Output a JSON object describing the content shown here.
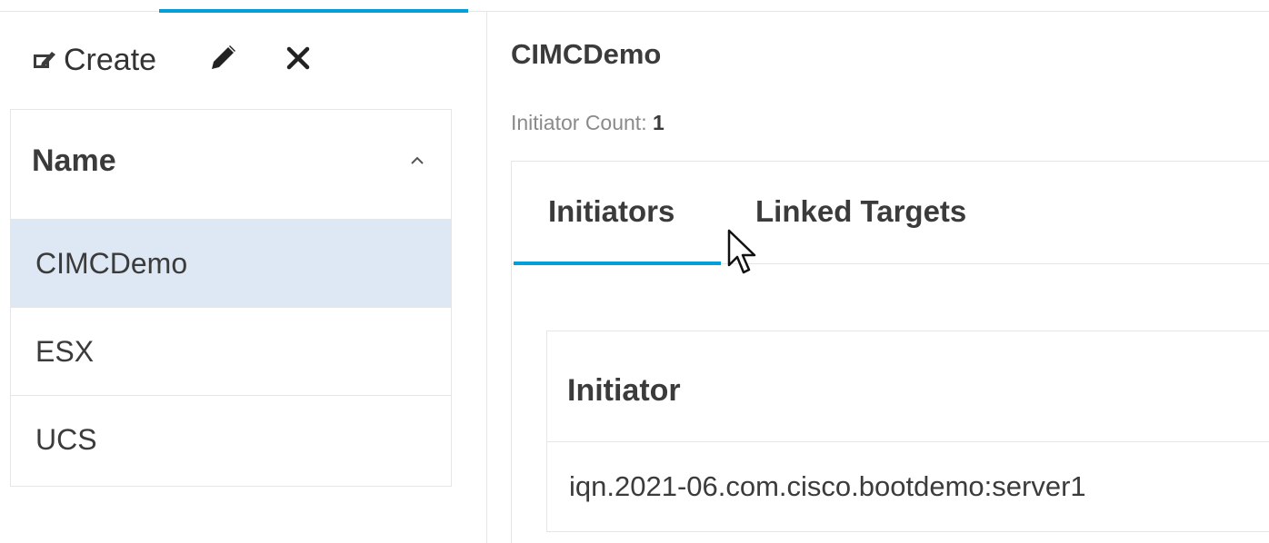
{
  "toolbar": {
    "create_label": "Create",
    "create_icon": "create-edit-icon",
    "edit_icon": "pencil-icon",
    "delete_icon": "close-icon"
  },
  "list": {
    "header": "Name",
    "sort_icon": "chevron-up-icon",
    "rows": [
      "CIMCDemo",
      "ESX",
      "UCS"
    ],
    "selected": "CIMCDemo"
  },
  "detail": {
    "title": "CIMCDemo",
    "count_label": "Initiator Count:",
    "count_value": "1",
    "tabs": [
      {
        "label": "Initiators",
        "active": true
      },
      {
        "label": "Linked Targets",
        "active": false
      }
    ],
    "table": {
      "header": "Initiator",
      "rows": [
        "iqn.2021-06.com.cisco.bootdemo:server1"
      ]
    }
  },
  "colors": {
    "accent": "#049fd9",
    "selected_row": "#dde8f4",
    "border": "#e6e6e6",
    "text": "#3b3b3b",
    "muted_text": "#8a8a8a"
  }
}
